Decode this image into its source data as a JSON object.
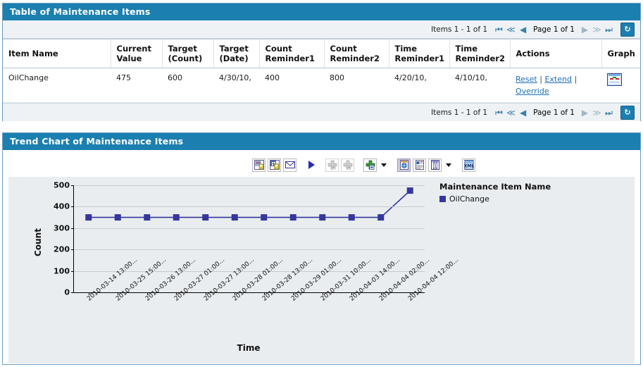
{
  "table_panel": {
    "title": "Table of Maintenance Items",
    "pager": {
      "items_text": "Items 1 - 1 of 1",
      "page_text": "Page 1 of 1",
      "first_icon": "first-page-icon",
      "prev_fast_icon": "previous-fast-icon",
      "prev_icon": "previous-page-icon",
      "next_icon": "next-page-icon",
      "next_fast_icon": "next-fast-icon",
      "last_icon": "last-page-icon",
      "refresh_icon": "refresh-icon",
      "first_glyph": "⏮",
      "prev_fast_glyph": "≪",
      "prev_glyph": "◀",
      "next_glyph": "▶",
      "next_fast_glyph": "≫",
      "last_glyph": "⏭",
      "refresh_glyph": "↻"
    },
    "columns": [
      "Item Name",
      "Current Value",
      "Target (Count)",
      "Target (Date)",
      "Count Reminder1",
      "Count Reminder2",
      "Time Reminder1",
      "Time Reminder2",
      "Actions",
      "Graph"
    ],
    "rows": [
      {
        "item_name": "OilChange",
        "current_value": "475",
        "target_count": "600",
        "target_date": "4/30/10,",
        "count_reminder1": "400",
        "count_reminder2": "800",
        "time_reminder1": "4/20/10,",
        "time_reminder2": "4/10/10,",
        "action_reset": "Reset",
        "action_extend": "Extend",
        "action_override": "Override",
        "separator": "|",
        "graph_icon": "line-graph-icon"
      }
    ]
  },
  "chart_panel": {
    "title": "Trend Chart of Maintenance Items",
    "toolbar": [
      {
        "name": "save-icon",
        "state": "enabled"
      },
      {
        "name": "save-as-icon",
        "state": "enabled"
      },
      {
        "name": "email-icon",
        "state": "enabled"
      },
      {
        "name": "run-icon",
        "state": "enabled"
      },
      {
        "name": "collapse-all-icon",
        "state": "disabled"
      },
      {
        "name": "expand-all-icon",
        "state": "disabled"
      },
      {
        "name": "add-chart-icon",
        "state": "enabled"
      },
      {
        "name": "add-chart-dropdown-icon",
        "state": "dropdown"
      },
      {
        "name": "export-html-icon",
        "state": "selected"
      },
      {
        "name": "export-report-icon",
        "state": "enabled"
      },
      {
        "name": "export-table-icon",
        "state": "enabled"
      },
      {
        "name": "export-table-dropdown-icon",
        "state": "dropdown"
      },
      {
        "name": "export-xml-icon",
        "state": "enabled"
      }
    ]
  },
  "chart_data": {
    "type": "line",
    "title": "",
    "xlabel": "Time",
    "ylabel": "Count",
    "ylim": [
      0,
      500
    ],
    "yticks": [
      0,
      100,
      200,
      300,
      400,
      500
    ],
    "grid": true,
    "legend_position": "right",
    "legend_title": "Maintenance Item Name",
    "categories": [
      "2010-03-14 13:00...",
      "2010-03-25 15:00...",
      "2010-03-26 13:00...",
      "2010-03-27 01:00...",
      "2010-03-27 13:00...",
      "2010-03-28 01:00...",
      "2010-03-28 13:00...",
      "2010-03-29 01:00...",
      "2010-03-31 10:00...",
      "2010-04-03 14:00...",
      "2010-04-04 02:00...",
      "2010-04-04 12:00..."
    ],
    "series": [
      {
        "name": "OilChange",
        "color": "#36369c",
        "values": [
          350,
          350,
          350,
          350,
          350,
          350,
          350,
          350,
          350,
          350,
          350,
          475
        ]
      }
    ]
  },
  "colors": {
    "panel_header": "#1b7fb0",
    "panel_border": "#6b9cc4",
    "link": "#1f6fb4",
    "series": "#36369c",
    "chart_background": "#e9edf0"
  }
}
